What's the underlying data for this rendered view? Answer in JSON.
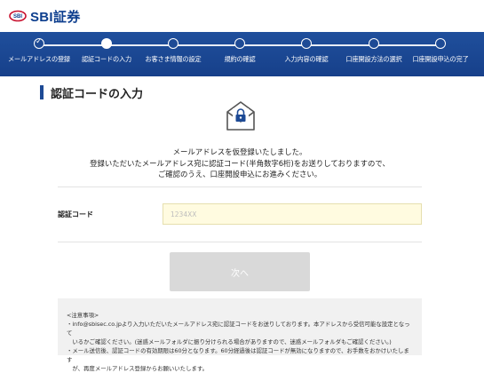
{
  "header": {
    "brand": "SBI証券"
  },
  "progress": {
    "steps": [
      {
        "label": "メールアドレスの登録",
        "state": "done"
      },
      {
        "label": "認証コードの入力",
        "state": "current"
      },
      {
        "label": "お客さま情報の設定",
        "state": "todo"
      },
      {
        "label": "規約の確認",
        "state": "todo"
      },
      {
        "label": "入力内容の確認",
        "state": "todo"
      },
      {
        "label": "口座開設方法の選択",
        "state": "todo"
      },
      {
        "label": "口座開設申込の完了",
        "state": "todo"
      }
    ]
  },
  "page": {
    "title": "認証コードの入力",
    "icon": "envelope-lock-icon",
    "message_lines": [
      "メールアドレスを仮登録いたしました。",
      "登録いただいたメールアドレス宛に認証コード(半角数字6桁)をお送りしておりますので、",
      "ご確認のうえ、口座開設申込にお進みください。"
    ]
  },
  "form": {
    "code_label": "認証コード",
    "code_placeholder": "1234XX",
    "code_value": "",
    "next_label": "次へ"
  },
  "notes": {
    "heading": "<注意事項>",
    "lines": [
      "・info@sbisec.co.jpより入力いただいたメールアドレス宛に認証コードをお送りしております。本アドレスから受信可能な設定となって",
      "　いるかご確認ください。(迷惑メールフォルダに振り分けられる場合がありますので、迷惑メールフォルダもご確認ください。)",
      "・メール送信後、認証コードの有効期限は60分となります。60分経過後は認証コードが無効になりますので、お手数をおかけいたします",
      "　が、再度メールアドレス登録からお願いいたします。"
    ]
  },
  "colors": {
    "brand_blue": "#1d4a95",
    "input_bg": "#fffbe0",
    "disabled_button": "#d9d9d9",
    "notes_bg": "#f1f1f1"
  }
}
